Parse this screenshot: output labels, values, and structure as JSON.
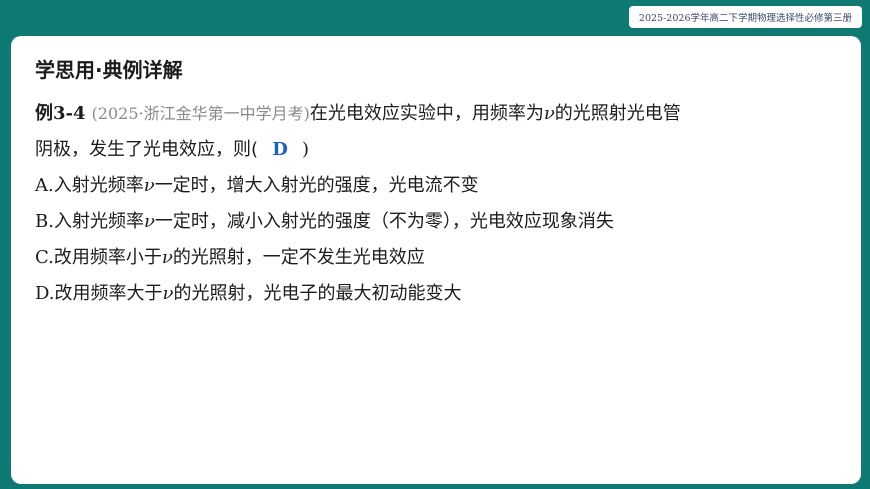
{
  "header": {
    "badge": "2025-2026学年高二下学期物理选择性必修第三册"
  },
  "section": {
    "title": "学思用·典例详解"
  },
  "question": {
    "label": "例3-4",
    "source": "(2025·浙江金华第一中学月考)",
    "stem_part1": "在光电效应实验中，用频率为",
    "nu": "ν",
    "stem_part2": "的光照射光电管",
    "stem_line2": "阴极，发生了光电效应，则(",
    "answer": "D",
    "close_paren": ")"
  },
  "options": [
    {
      "letter": "A.",
      "pre": "入射光频率",
      "nu": "ν",
      "post": "一定时，增大入射光的强度，光电流不变"
    },
    {
      "letter": "B.",
      "pre": "入射光频率",
      "nu": "ν",
      "post": "一定时，减小入射光的强度（不为零），光电效应现象消失"
    },
    {
      "letter": "C.",
      "pre": "改用频率小于",
      "nu": "ν",
      "post": "的光照射，一定不发生光电效应"
    },
    {
      "letter": "D.",
      "pre": "改用频率大于",
      "nu": "ν",
      "post": "的光照射，光电子的最大初动能变大"
    }
  ]
}
